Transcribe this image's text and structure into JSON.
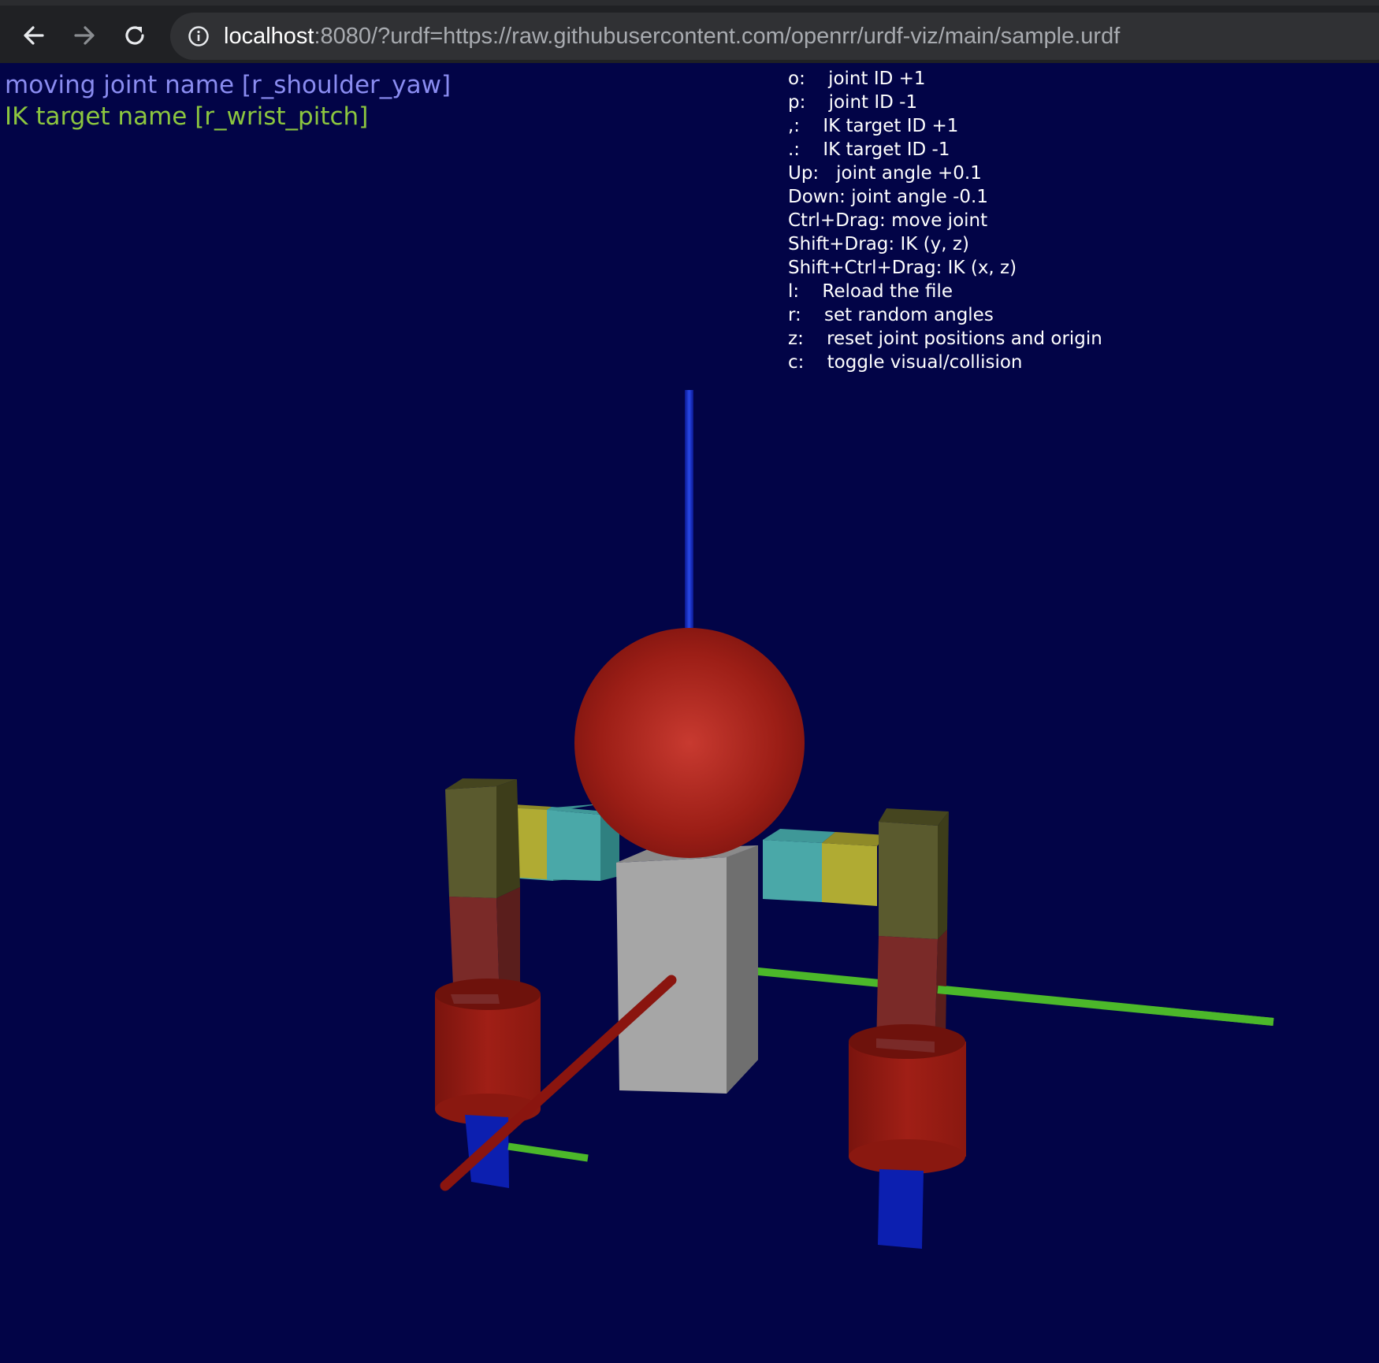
{
  "browser": {
    "url_host": "localhost",
    "url_rest": ":8080/?urdf=https://raw.githubusercontent.com/openrr/urdf-viz/main/sample.urdf",
    "icons": {
      "back": "arrow-left-icon",
      "forward": "arrow-right-icon",
      "reload": "reload-icon",
      "info": "info-circle-icon"
    }
  },
  "status": {
    "moving_joint": "moving joint name [r_shoulder_yaw]",
    "ik_target": "IK target name [r_wrist_pitch]",
    "moving_joint_color": "#8a8cf0",
    "ik_target_color": "#8cc63f"
  },
  "help": [
    {
      "key": "o:    ",
      "desc": "joint ID +1"
    },
    {
      "key": "p:    ",
      "desc": "joint ID -1"
    },
    {
      "key": ",:    ",
      "desc": "IK target ID +1"
    },
    {
      "key": ".:    ",
      "desc": "IK target ID -1"
    },
    {
      "key": "Up:   ",
      "desc": "joint angle +0.1"
    },
    {
      "key": "Down: ",
      "desc": "joint angle -0.1"
    },
    {
      "key": "Ctrl+Drag: ",
      "desc": "move joint"
    },
    {
      "key": "Shift+Drag: ",
      "desc": "IK (y, z)"
    },
    {
      "key": "Shift+Ctrl+Drag: ",
      "desc": "IK (x, z)"
    },
    {
      "key": "l:    ",
      "desc": "Reload the file"
    },
    {
      "key": "r:    ",
      "desc": "set random angles"
    },
    {
      "key": "z:    ",
      "desc": "reset joint positions and origin"
    },
    {
      "key": "c:    ",
      "desc": "toggle visual/collision"
    }
  ],
  "scene": {
    "background": "#020447",
    "colors": {
      "head": "#a0201a",
      "torso": "#a6a6a6",
      "shoulder": "#b3b030",
      "arm_link": "#4aa8a8",
      "upper_arm": "#5a5a2e",
      "elbow": "#7a2a28",
      "forearm_cylinder": "#8e1a12",
      "hand": "#0c1fb0",
      "axis_x": "#8a150f",
      "axis_y": "#4cb82a",
      "axis_z": "#1028c8"
    }
  }
}
